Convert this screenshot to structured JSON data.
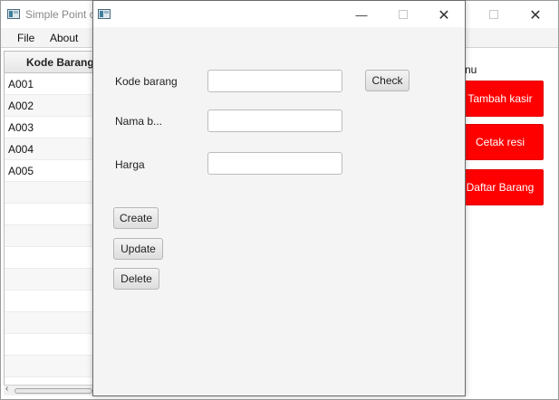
{
  "main_window": {
    "title": "Simple Point o",
    "menu": [
      "File",
      "About"
    ],
    "table": {
      "column_header": "Kode Barang",
      "rows": [
        "A001",
        "A002",
        "A003",
        "A004",
        "A005"
      ]
    },
    "side_menu": {
      "label": "nu",
      "buttons": [
        "Tambah kasir",
        "Cetak resi",
        "Daftar Barang"
      ],
      "button_color": "#ff0000"
    }
  },
  "dialog": {
    "fields": [
      {
        "label": "Kode barang",
        "value": "",
        "placeholder": ""
      },
      {
        "label": "Nama b...",
        "value": "",
        "placeholder": ""
      },
      {
        "label": "Harga",
        "value": "",
        "placeholder": ""
      }
    ],
    "check_button": "Check",
    "actions": [
      "Create",
      "Update",
      "Delete"
    ]
  },
  "controls": {
    "minimize_glyph": "—",
    "close_glyph": "✕"
  }
}
